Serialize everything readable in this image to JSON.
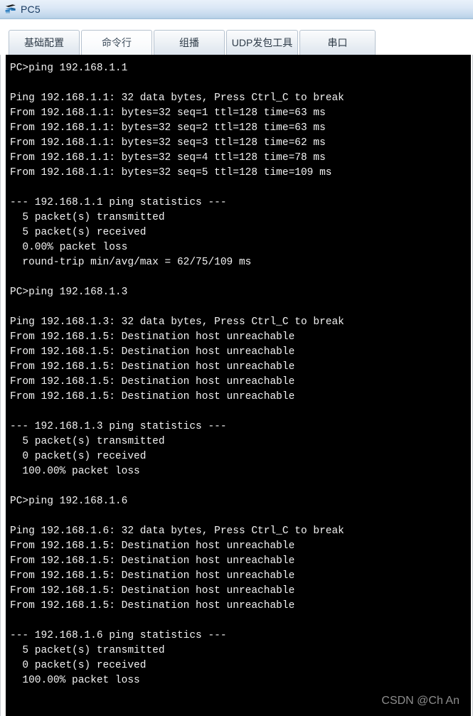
{
  "window": {
    "title": "PC5",
    "icon": "pc-device-icon"
  },
  "tabs": [
    {
      "label": "基础配置",
      "active": false,
      "name": "tab-basic-config"
    },
    {
      "label": "命令行",
      "active": true,
      "name": "tab-command-line"
    },
    {
      "label": "组播",
      "active": false,
      "name": "tab-multicast"
    },
    {
      "label": "UDP发包工具",
      "active": false,
      "name": "tab-udp-tool"
    },
    {
      "label": "串口",
      "active": false,
      "name": "tab-serial-port"
    }
  ],
  "terminal": {
    "background": "#000000",
    "foreground": "#f2f2f2",
    "lines": [
      "PC>ping 192.168.1.1",
      "",
      "Ping 192.168.1.1: 32 data bytes, Press Ctrl_C to break",
      "From 192.168.1.1: bytes=32 seq=1 ttl=128 time=63 ms",
      "From 192.168.1.1: bytes=32 seq=2 ttl=128 time=63 ms",
      "From 192.168.1.1: bytes=32 seq=3 ttl=128 time=62 ms",
      "From 192.168.1.1: bytes=32 seq=4 ttl=128 time=78 ms",
      "From 192.168.1.1: bytes=32 seq=5 ttl=128 time=109 ms",
      "",
      "--- 192.168.1.1 ping statistics ---",
      "  5 packet(s) transmitted",
      "  5 packet(s) received",
      "  0.00% packet loss",
      "  round-trip min/avg/max = 62/75/109 ms",
      "",
      "PC>ping 192.168.1.3",
      "",
      "Ping 192.168.1.3: 32 data bytes, Press Ctrl_C to break",
      "From 192.168.1.5: Destination host unreachable",
      "From 192.168.1.5: Destination host unreachable",
      "From 192.168.1.5: Destination host unreachable",
      "From 192.168.1.5: Destination host unreachable",
      "From 192.168.1.5: Destination host unreachable",
      "",
      "--- 192.168.1.3 ping statistics ---",
      "  5 packet(s) transmitted",
      "  0 packet(s) received",
      "  100.00% packet loss",
      "",
      "PC>ping 192.168.1.6",
      "",
      "Ping 192.168.1.6: 32 data bytes, Press Ctrl_C to break",
      "From 192.168.1.5: Destination host unreachable",
      "From 192.168.1.5: Destination host unreachable",
      "From 192.168.1.5: Destination host unreachable",
      "From 192.168.1.5: Destination host unreachable",
      "From 192.168.1.5: Destination host unreachable",
      "",
      "--- 192.168.1.6 ping statistics ---",
      "  5 packet(s) transmitted",
      "  0 packet(s) received",
      "  100.00% packet loss"
    ]
  },
  "watermark": {
    "text": "CSDN @Ch An"
  }
}
